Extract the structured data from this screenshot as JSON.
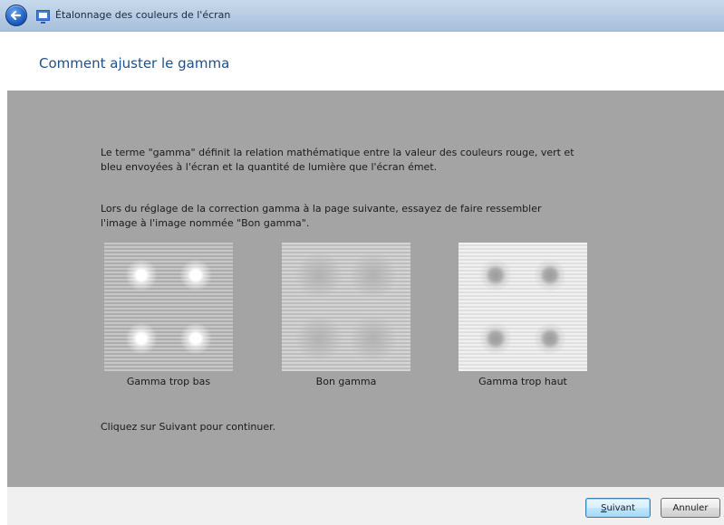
{
  "window": {
    "title": "Étalonnage des couleurs de l'écran",
    "back_icon": "back-arrow-icon",
    "app_icon": "monitor-icon"
  },
  "page": {
    "heading": "Comment ajuster le gamma"
  },
  "content": {
    "paragraph1": [
      "Le terme \"gamma\" définit la relation mathématique entre la valeur des couleurs rouge, vert et",
      "bleu envoyées à l'écran et la quantité de lumière que l'écran émet."
    ],
    "paragraph2": [
      "Lors du réglage de la correction gamma à la page suivante, essayez de faire ressembler",
      "l'image à l'image nommée \"Bon gamma\"."
    ],
    "samples": [
      {
        "caption": "Gamma trop bas"
      },
      {
        "caption": "Bon gamma"
      },
      {
        "caption": "Gamma trop haut"
      }
    ],
    "instruction": "Cliquez sur Suivant pour continuer."
  },
  "buttons": {
    "next_accesskey": "S",
    "next_rest": "uivant",
    "cancel": "Annuler"
  },
  "colors": {
    "content_background": "#a4a4a4",
    "heading": "#1f4f8c",
    "footer_background": "#f0f0f0"
  }
}
